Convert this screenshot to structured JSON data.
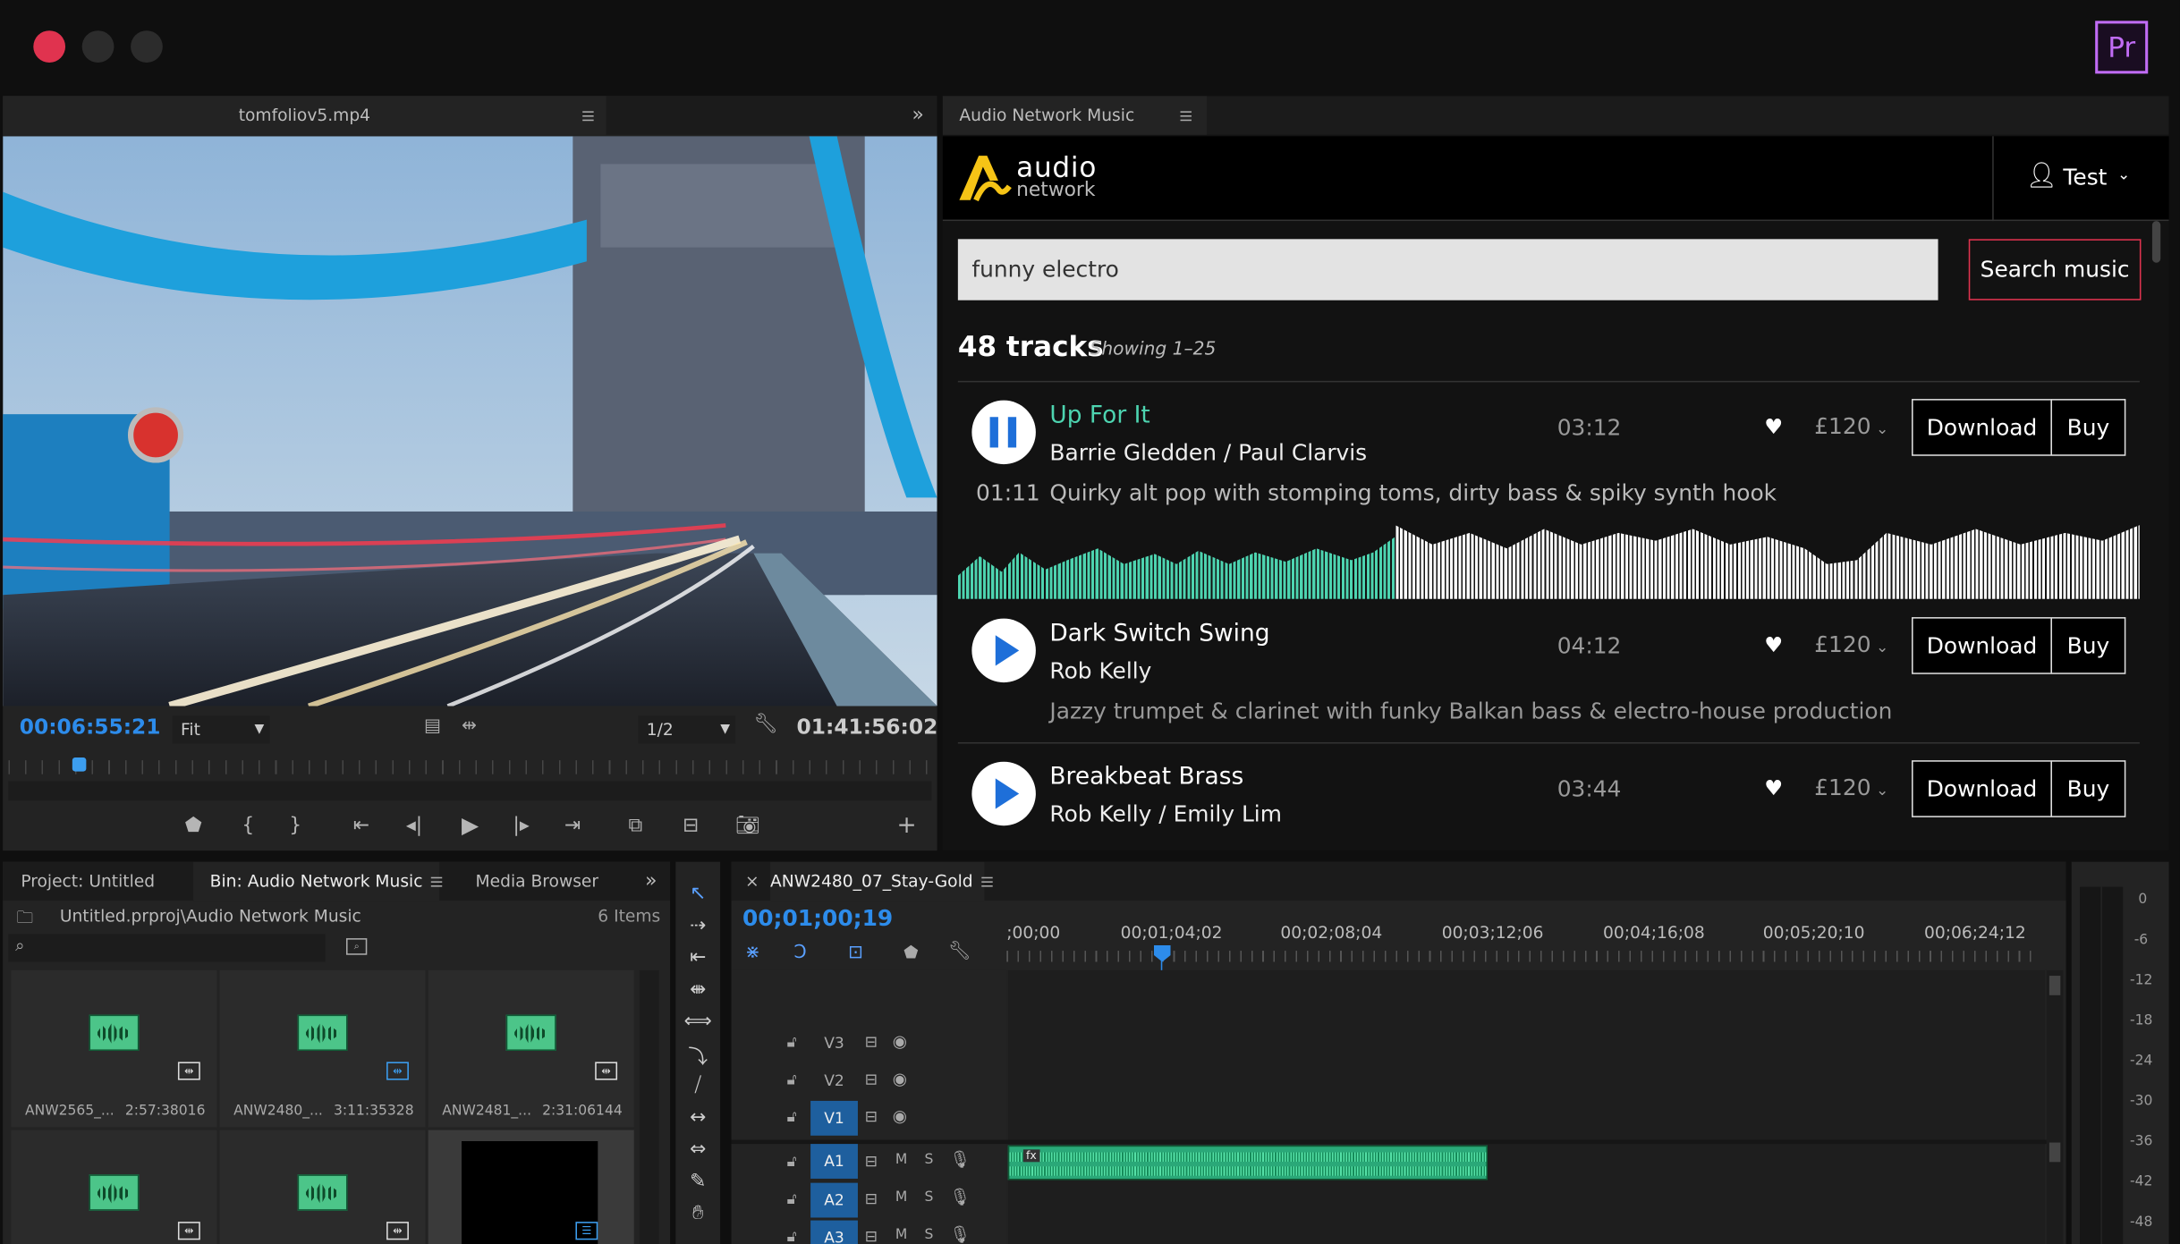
{
  "app": {
    "logo": "Pr",
    "traffic_colors": [
      "#e0334f",
      "#2c2c2c",
      "#2c2c2c"
    ]
  },
  "source_monitor": {
    "tab_title": "tomfoliov5.mp4",
    "current_timecode": "00:06:55:21",
    "zoom": "Fit",
    "resolution": "1/2",
    "duration": "01:41:56:02",
    "video_description": "Tower Bridge, London at dusk with light trails",
    "playhead_fraction": 0.07
  },
  "audio_network": {
    "tab_title": "Audio Network Music",
    "logo_word1": "audio",
    "logo_word2": "network",
    "user": "Test",
    "search_value": "funny electro",
    "search_button": "Search music",
    "count": "48 tracks",
    "showing": "Showing 1–25",
    "tracks": [
      {
        "title": "Up For It",
        "artist": "Barrie Gledden / Paul Clarvis",
        "duration": "03:12",
        "price": "£120",
        "elapsed": "01:11",
        "description": "Quirky alt pop with stomping toms, dirty bass & spiky synth hook",
        "playing": true,
        "progress": 0.37,
        "download": "Download",
        "buy": "Buy"
      },
      {
        "title": "Dark Switch Swing",
        "artist": "Rob Kelly",
        "duration": "04:12",
        "price": "£120",
        "description": "Jazzy trumpet & clarinet with funky Balkan bass & electro-house production",
        "playing": false,
        "download": "Download",
        "buy": "Buy"
      },
      {
        "title": "Breakbeat Brass",
        "artist": "Rob Kelly / Emily Lim",
        "duration": "03:44",
        "price": "£120",
        "playing": false,
        "download": "Download",
        "buy": "Buy"
      }
    ],
    "accent_color": "#4dd4b0",
    "search_border_color": "#e0334f"
  },
  "project_panel": {
    "tabs": [
      "Project: Untitled",
      "Bin: Audio Network Music",
      "Media Browser"
    ],
    "path": "Untitled.prproj\\Audio Network Music",
    "item_count": "6 Items",
    "items": [
      {
        "name": "ANW2565_...",
        "duration": "2:57:38016"
      },
      {
        "name": "ANW2480_...",
        "duration": "3:11:35328"
      },
      {
        "name": "ANW2481_...",
        "duration": "2:31:06144"
      }
    ]
  },
  "timeline": {
    "tab_title": "ANW2480_07_Stay-Gold",
    "timecode": "00;01;00;19",
    "ruler": [
      ";00;00",
      "00;01;04;02",
      "00;02;08;04",
      "00;03;12;06",
      "00;04;16;08",
      "00;05;20;10",
      "00;06;24;12"
    ],
    "video_tracks": [
      "V3",
      "V2",
      "V1"
    ],
    "audio_tracks": [
      "A1",
      "A2",
      "A3"
    ],
    "mute_label": "M",
    "solo_label": "S",
    "clip_badge": "fx"
  },
  "meter": {
    "labels": [
      "0",
      "-6",
      "-12",
      "-18",
      "-24",
      "-30",
      "-36",
      "-42",
      "-48"
    ]
  }
}
